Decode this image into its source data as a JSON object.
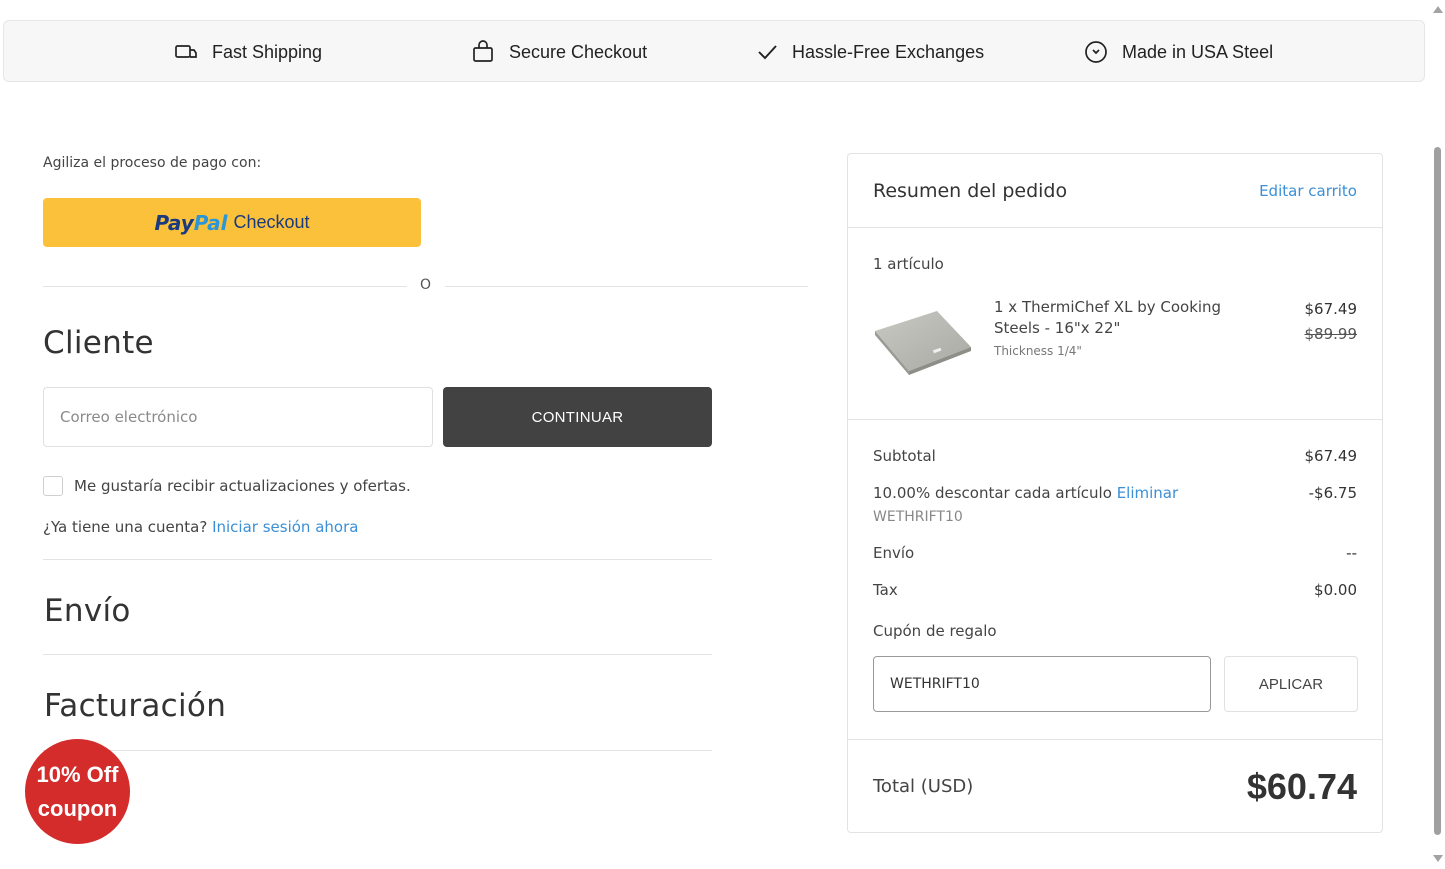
{
  "trust_bar": {
    "items": [
      {
        "label": "Fast Shipping",
        "icon": "truck-icon"
      },
      {
        "label": "Secure Checkout",
        "icon": "shopping-bag-icon"
      },
      {
        "label": "Hassle-Free Exchanges",
        "icon": "checkmark-icon"
      },
      {
        "label": "Made in USA Steel",
        "icon": "arrow-circle-icon"
      }
    ]
  },
  "express": {
    "label": "Agiliza el proceso de pago con:",
    "paypal_pay": "Pay",
    "paypal_pal": "Pal",
    "paypal_checkout": "Checkout",
    "or": "O"
  },
  "customer": {
    "title": "Cliente",
    "email_placeholder": "Correo electrónico",
    "continue_label": "CONTINUAR",
    "newsletter_label": "Me gustaría recibir actualizaciones y ofertas.",
    "account_prompt": "¿Ya tiene una cuenta?",
    "login_link": "Iniciar sesión ahora"
  },
  "sections": {
    "shipping": "Envío",
    "billing": "Facturación"
  },
  "coupon_badge": {
    "line1": "10% Off",
    "line2": "coupon"
  },
  "summary": {
    "title": "Resumen del pedido",
    "edit_cart": "Editar carrito",
    "item_count": "1 artículo",
    "product": {
      "name": "1 x ThermiChef XL by Cooking Steels - 16\"x 22\"",
      "option": "Thickness 1/4\"",
      "price": "$67.49",
      "original_price": "$89.99"
    },
    "subtotal_label": "Subtotal",
    "subtotal_value": "$67.49",
    "discount_label": "10.00% descontar cada artículo",
    "discount_remove": "Eliminar",
    "discount_code": "WETHRIFT10",
    "discount_value": "-$6.75",
    "shipping_label": "Envío",
    "shipping_value": "--",
    "tax_label": "Tax",
    "tax_value": "$0.00",
    "gift_label": "Cupón de regalo",
    "gift_input_value": "WETHRIFT10",
    "apply_label": "APLICAR",
    "total_label": "Total (USD)",
    "total_value": "$60.74"
  },
  "colors": {
    "accent_link": "#3b8fd6",
    "paypal_yellow": "#fbc13a",
    "dark_button": "#424242",
    "badge_red": "#d42b2b"
  }
}
